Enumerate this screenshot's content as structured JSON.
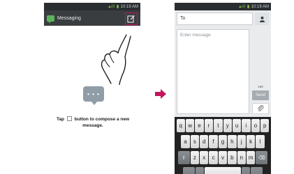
{
  "status_bar": {
    "time": "10:19 AM"
  },
  "left_screen": {
    "app_title": "Messaging",
    "bubble_text": "• • •",
    "instruction_before": "Tap",
    "instruction_after": "button to compose a new message."
  },
  "right_screen": {
    "to_placeholder": "To",
    "message_placeholder": "Enter message",
    "char_counter": "160",
    "send_label": "Send",
    "keyboard_rows": [
      [
        "q",
        "w",
        "e",
        "r",
        "t",
        "y",
        "u",
        "i",
        "o",
        "p"
      ],
      [
        "a",
        "s",
        "d",
        "f",
        "g",
        "h",
        "j",
        "k",
        "l"
      ],
      [
        "z",
        "x",
        "c",
        "v",
        "b",
        "n",
        "m"
      ]
    ]
  },
  "colors": {
    "highlight": "#c4165b",
    "arrow": "#c4165b",
    "bubble": "#909da7"
  },
  "icons": [
    "signal-icon",
    "battery-icon",
    "messaging-app-icon",
    "compose-icon",
    "pointing-hand-icon",
    "message-bubble-icon",
    "next-arrow-icon",
    "contact-icon",
    "attach-icon",
    "shift-icon",
    "backspace-icon"
  ]
}
